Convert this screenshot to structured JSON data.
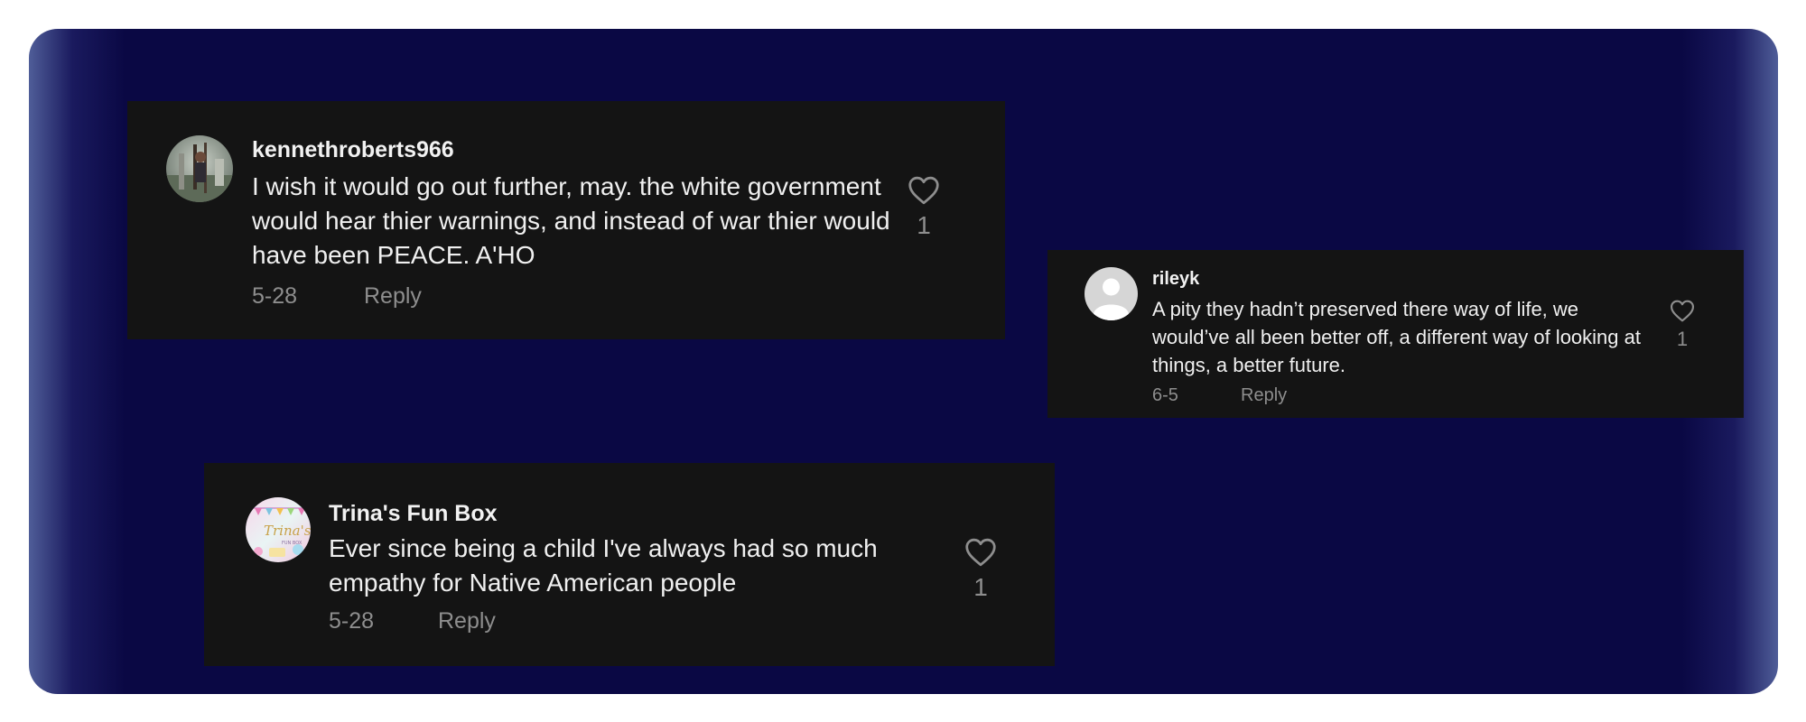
{
  "comments": [
    {
      "username": "kennethroberts966",
      "text": "I wish it would go out further, may. the white government would hear thier warnings, and instead of war thier would have been PEACE. A'HO",
      "date": "5-28",
      "reply_label": "Reply",
      "likes": "1",
      "avatar_icon": "photo-avatar-icon"
    },
    {
      "username": "rileyk",
      "text": "A pity they hadn’t preserved there way of life, we would’ve all been better off, a different way of looking at things, a better future.",
      "date": "6-5",
      "reply_label": "Reply",
      "likes": "1",
      "avatar_icon": "default-user-avatar-icon"
    },
    {
      "username": "Trina's Fun Box",
      "text": "Ever since being a child I've always had so much empathy for Native American people",
      "date": "5-28",
      "reply_label": "Reply",
      "likes": "1",
      "avatar_icon": "logo-avatar-icon",
      "avatar_logo_text": [
        "Trina's",
        "FUN BOX"
      ]
    }
  ],
  "colors": {
    "background": "#0a0844",
    "card": "#141414",
    "text_primary": "#f0f0f0",
    "text_secondary": "#8e8e8e"
  }
}
